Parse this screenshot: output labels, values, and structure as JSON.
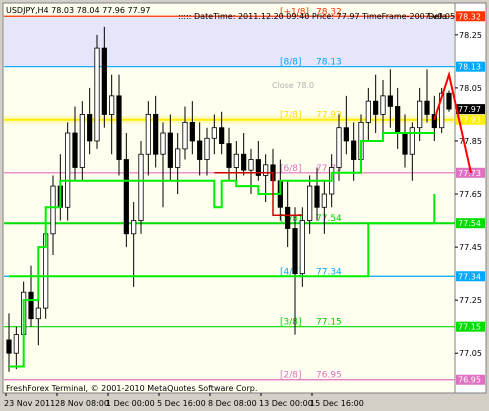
{
  "window": {
    "symbol_line": "USDJPY,H4  78.03 78.04 77.96 77.97",
    "info_line": "::::: DateTime: 2011.12.20 09:40   Price: 77.97   TimeFrame-2007-v0.05",
    "info_overflow": "Defa",
    "close_marker_label": "Close 78.0",
    "copyright": "FreshForex Terminal, © 2001-2010 MetaQuotes Software Corp."
  },
  "colors": {
    "background": "#fffff0",
    "band_upper": "#e6e6fa",
    "band_yellow": "#fff9a0",
    "bull_candle": "#ffffff",
    "bear_candle": "#000000",
    "wick": "#000000",
    "green_line": "#00ee00",
    "red_line": "#cc0000",
    "red_arrow": "#ff0000",
    "price_axis_bg": "#ffffff"
  },
  "chart_data": {
    "type": "candlestick",
    "symbol": "USDJPY",
    "timeframe": "H4",
    "ylim": [
      76.9,
      78.37
    ],
    "x_ticks": [
      "23 Nov 2011",
      "28 Nov 08:00",
      "1 Dec 00:00",
      "5 Dec 16:00",
      "8 Dec 08:00",
      "13 Dec 00:00",
      "15 Dec 16:00"
    ],
    "price_ticks": [
      "78.25",
      "78.05",
      "77.85",
      "77.65",
      "77.45",
      "77.25",
      "77.05"
    ],
    "current_price": 77.97,
    "ohlc": [
      [
        77.1,
        77.2,
        76.98,
        77.05
      ],
      [
        77.05,
        77.15,
        76.99,
        77.12
      ],
      [
        77.12,
        77.32,
        77.05,
        77.28
      ],
      [
        77.28,
        77.38,
        77.15,
        77.18
      ],
      [
        77.18,
        77.25,
        77.08,
        77.22
      ],
      [
        77.22,
        77.55,
        77.18,
        77.5
      ],
      [
        77.5,
        77.72,
        77.42,
        77.68
      ],
      [
        77.68,
        77.8,
        77.55,
        77.6
      ],
      [
        77.6,
        77.92,
        77.55,
        77.88
      ],
      [
        77.88,
        77.98,
        77.7,
        77.75
      ],
      [
        77.75,
        78.0,
        77.7,
        77.95
      ],
      [
        77.95,
        78.05,
        77.8,
        77.85
      ],
      [
        77.85,
        78.25,
        77.82,
        78.2
      ],
      [
        78.2,
        78.28,
        77.9,
        77.95
      ],
      [
        77.95,
        78.1,
        77.8,
        78.02
      ],
      [
        78.02,
        78.1,
        77.72,
        77.78
      ],
      [
        77.78,
        77.88,
        77.45,
        77.5
      ],
      [
        77.5,
        77.62,
        77.3,
        77.55
      ],
      [
        77.55,
        77.85,
        77.5,
        77.8
      ],
      [
        77.8,
        78.0,
        77.72,
        77.95
      ],
      [
        77.95,
        78.02,
        77.75,
        77.8
      ],
      [
        77.8,
        77.92,
        77.6,
        77.88
      ],
      [
        77.88,
        77.95,
        77.7,
        77.75
      ],
      [
        77.75,
        77.88,
        77.65,
        77.82
      ],
      [
        77.82,
        77.98,
        77.78,
        77.92
      ],
      [
        77.92,
        78.0,
        77.8,
        77.85
      ],
      [
        77.85,
        77.92,
        77.72,
        77.78
      ],
      [
        77.78,
        77.9,
        77.72,
        77.86
      ],
      [
        77.86,
        77.95,
        77.8,
        77.9
      ],
      [
        77.9,
        77.96,
        77.8,
        77.84
      ],
      [
        77.84,
        77.9,
        77.7,
        77.75
      ],
      [
        77.75,
        77.85,
        77.68,
        77.8
      ],
      [
        77.8,
        77.88,
        77.72,
        77.74
      ],
      [
        77.74,
        77.82,
        77.65,
        77.78
      ],
      [
        77.78,
        77.85,
        77.7,
        77.72
      ],
      [
        77.72,
        77.8,
        77.62,
        77.76
      ],
      [
        77.76,
        77.82,
        77.66,
        77.7
      ],
      [
        77.7,
        77.78,
        77.55,
        77.6
      ],
      [
        77.6,
        77.7,
        77.45,
        77.52
      ],
      [
        77.52,
        77.6,
        77.12,
        77.35
      ],
      [
        77.35,
        77.6,
        77.3,
        77.55
      ],
      [
        77.55,
        77.72,
        77.5,
        77.68
      ],
      [
        77.68,
        77.75,
        77.55,
        77.6
      ],
      [
        77.6,
        77.7,
        77.5,
        77.65
      ],
      [
        77.65,
        77.8,
        77.6,
        77.75
      ],
      [
        77.75,
        77.95,
        77.7,
        77.9
      ],
      [
        77.9,
        78.02,
        77.8,
        77.85
      ],
      [
        77.85,
        77.92,
        77.7,
        77.78
      ],
      [
        77.78,
        77.95,
        77.75,
        77.92
      ],
      [
        77.92,
        78.05,
        77.85,
        78.0
      ],
      [
        78.0,
        78.1,
        77.88,
        77.95
      ],
      [
        77.95,
        78.08,
        77.85,
        78.02
      ],
      [
        78.02,
        78.12,
        77.9,
        77.98
      ],
      [
        77.98,
        78.05,
        77.82,
        77.88
      ],
      [
        77.88,
        77.95,
        77.75,
        77.8
      ],
      [
        77.8,
        77.92,
        77.7,
        77.9
      ],
      [
        77.9,
        78.05,
        77.85,
        78.0
      ],
      [
        78.0,
        78.12,
        77.92,
        77.95
      ],
      [
        77.95,
        78.02,
        77.85,
        77.9
      ],
      [
        77.9,
        78.05,
        77.88,
        78.03
      ],
      [
        78.03,
        78.04,
        77.96,
        77.97
      ]
    ],
    "murray_levels": [
      {
        "label": "[+1/8]",
        "value": "78.32",
        "price": 78.32,
        "color": "#ff3300",
        "text_color": "#ff3300",
        "thick": false
      },
      {
        "label": "[8/8]",
        "value": "78.13",
        "price": 78.13,
        "color": "#00a8ff",
        "text_color": "#00a8ff",
        "thick": false
      },
      {
        "label": "[7/8]",
        "value": "77.93",
        "price": 77.93,
        "color": "#ffee00",
        "text_color": "#ffdd00",
        "thick": true
      },
      {
        "label": "[6/8]",
        "value": "77.73",
        "price": 77.73,
        "color": "#e070c0",
        "text_color": "#e070c0",
        "thick": false
      },
      {
        "label": "[5/8]",
        "value": "77.54",
        "price": 77.54,
        "color": "#00dd00",
        "text_color": "#00cc00",
        "thick": true
      },
      {
        "label": "[4/8]",
        "value": "77.34",
        "price": 77.34,
        "color": "#00a8ff",
        "text_color": "#00a8ff",
        "thick": false
      },
      {
        "label": "[3/8]",
        "value": "77.15",
        "price": 77.15,
        "color": "#00dd00",
        "text_color": "#00cc00",
        "thick": false
      },
      {
        "label": "[2/8]",
        "value": "76.95",
        "price": 76.95,
        "color": "#e070c0",
        "text_color": "#e070c0",
        "thick": false
      }
    ],
    "green_step": [
      [
        0,
        77.0
      ],
      [
        2,
        77.0
      ],
      [
        2,
        77.25
      ],
      [
        4,
        77.25
      ],
      [
        4,
        77.45
      ],
      [
        5,
        77.45
      ],
      [
        5,
        77.6
      ],
      [
        7,
        77.6
      ],
      [
        7,
        77.7
      ],
      [
        28,
        77.7
      ],
      [
        28,
        77.6
      ],
      [
        29,
        77.6
      ],
      [
        29,
        77.7
      ],
      [
        31,
        77.7
      ],
      [
        31,
        77.68
      ],
      [
        34,
        77.68
      ],
      [
        34,
        77.65
      ],
      [
        37,
        77.65
      ],
      [
        37,
        77.7
      ],
      [
        44,
        77.7
      ],
      [
        44,
        77.73
      ],
      [
        48,
        77.73
      ],
      [
        48,
        77.85
      ],
      [
        51,
        77.85
      ],
      [
        51,
        77.88
      ],
      [
        58,
        77.88
      ]
    ],
    "green_lower_step": [
      [
        0,
        77.34
      ],
      [
        49,
        77.34
      ],
      [
        49,
        77.54
      ],
      [
        58,
        77.54
      ],
      [
        58,
        77.65
      ]
    ],
    "red_step": [
      [
        28,
        77.73
      ],
      [
        36,
        77.73
      ],
      [
        36,
        77.57
      ],
      [
        40,
        77.57
      ]
    ],
    "projection": [
      [
        58,
        77.93
      ],
      [
        60,
        78.1
      ],
      [
        63,
        77.73
      ]
    ]
  }
}
